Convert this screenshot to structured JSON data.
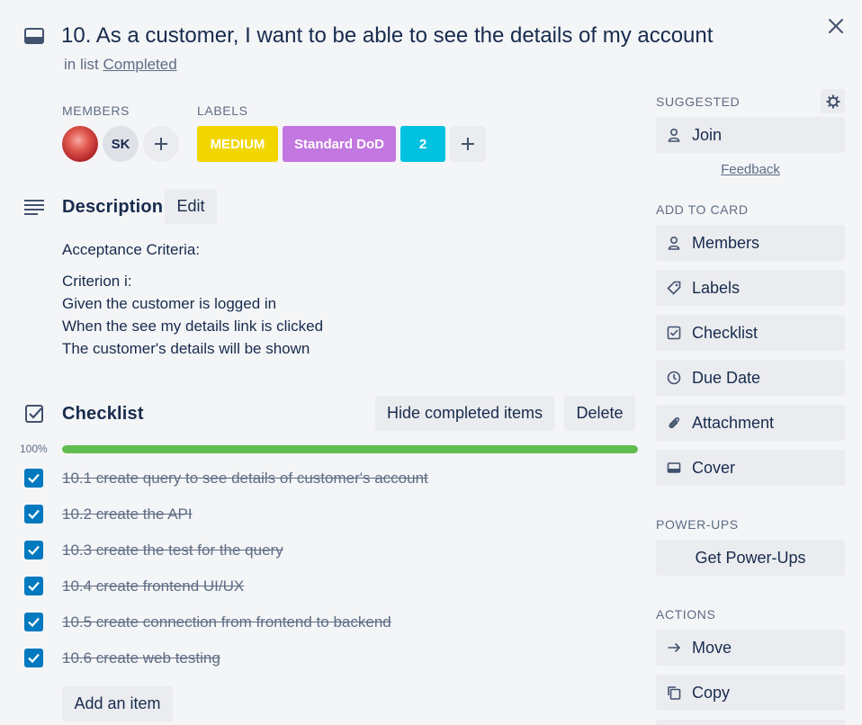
{
  "card": {
    "title": "10. As a customer, I want to be able to see the details of my account",
    "in_list_prefix": "in list",
    "list_name": "Completed"
  },
  "members": {
    "heading": "Members",
    "initials": "SK"
  },
  "labels": {
    "heading": "Labels",
    "items": [
      {
        "text": "MEDIUM",
        "color": "#f2d600"
      },
      {
        "text": "Standard DoD",
        "color": "#c377e0"
      },
      {
        "text": "2",
        "color": "#00c2e0"
      }
    ]
  },
  "description": {
    "heading": "Description",
    "edit_label": "Edit",
    "lines": [
      "Acceptance Criteria:",
      "Criterion i:",
      "Given the customer is logged in",
      "When the see my details link is clicked",
      "The customer's details will be shown"
    ]
  },
  "checklist": {
    "heading": "Checklist",
    "hide_label": "Hide completed items",
    "delete_label": "Delete",
    "percent_label": "100%",
    "progress": 1.0,
    "progress_color": "#61bd4f",
    "items": [
      "10.1 create query to see details of customer's account",
      "10.2 create the API",
      "10.3 create the test for the query",
      "10.4 create frontend UI/UX",
      "10.5 create connection from frontend to backend",
      "10.6 create web testing"
    ],
    "add_item_label": "Add an item"
  },
  "sidebar": {
    "suggested_heading": "Suggested",
    "join_label": "Join",
    "feedback_label": "Feedback",
    "add_to_card_heading": "Add to card",
    "add_to_card": [
      {
        "label": "Members",
        "icon": "person-icon"
      },
      {
        "label": "Labels",
        "icon": "tag-icon"
      },
      {
        "label": "Checklist",
        "icon": "checklist-icon"
      },
      {
        "label": "Due Date",
        "icon": "clock-icon"
      },
      {
        "label": "Attachment",
        "icon": "paperclip-icon"
      },
      {
        "label": "Cover",
        "icon": "cover-icon"
      }
    ],
    "powerups_heading": "Power-Ups",
    "get_powerups_label": "Get Power-Ups",
    "actions_heading": "Actions",
    "actions": [
      {
        "label": "Move",
        "icon": "arrow-right-icon"
      },
      {
        "label": "Copy",
        "icon": "copy-icon"
      }
    ]
  },
  "colors": {
    "accent": "#0079bf",
    "text": "#172b4d",
    "subtle": "#5e6c84",
    "button_bg": "#ebecf0"
  }
}
